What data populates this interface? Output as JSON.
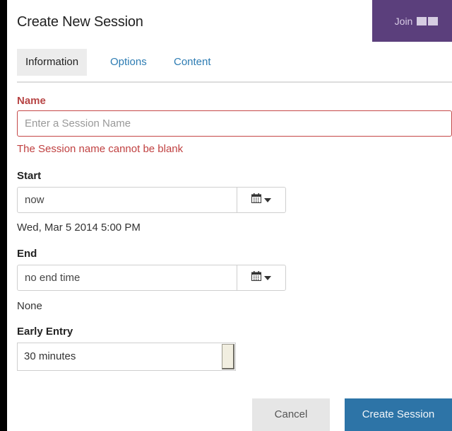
{
  "dialog": {
    "title": "Create New Session"
  },
  "join": {
    "label": "Join"
  },
  "tabs": [
    {
      "label": "Information",
      "active": true
    },
    {
      "label": "Options",
      "active": false
    },
    {
      "label": "Content",
      "active": false
    }
  ],
  "name": {
    "label": "Name",
    "placeholder": "Enter a Session Name",
    "value": "",
    "error": "The Session name cannot be blank"
  },
  "start": {
    "label": "Start",
    "value": "now",
    "resolved": "Wed, Mar 5 2014 5:00 PM"
  },
  "end": {
    "label": "End",
    "value": "no end time",
    "resolved": "None"
  },
  "early_entry": {
    "label": "Early Entry",
    "value": "30 minutes"
  },
  "actions": {
    "cancel_label": "Cancel",
    "create_label": "Create Session"
  },
  "colors": {
    "accent": "#2d74a7",
    "join_bg": "#5b3f7c",
    "error": "#c04141",
    "link": "#2d7cb3"
  },
  "icons": {
    "join": "screen-share-icon",
    "date_picker": "calendar-icon",
    "dropdown": "caret-down-icon"
  }
}
